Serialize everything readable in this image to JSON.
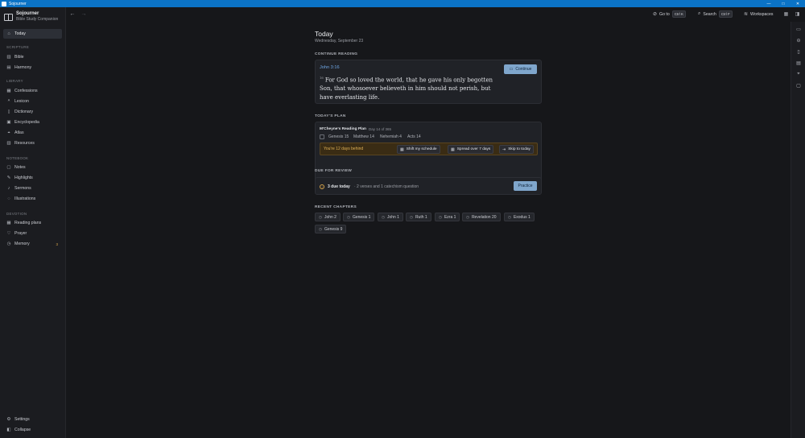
{
  "window": {
    "title": "Sojourner",
    "controls": [
      "—",
      "□",
      "✕"
    ]
  },
  "app": {
    "name": "Sojourner",
    "subtitle": "Bible Study Companion"
  },
  "sidebar": {
    "today": "Today",
    "sections": [
      {
        "label": "SCRIPTURE",
        "items": [
          "Bible",
          "Harmony"
        ]
      },
      {
        "label": "LIBRARY",
        "items": [
          "Confessions",
          "Lexicon",
          "Dictionary",
          "Encyclopedia",
          "Atlas",
          "Resources"
        ]
      },
      {
        "label": "NOTEBOOK",
        "items": [
          "Notes",
          "Highlights",
          "Sermons",
          "Illustrations"
        ]
      },
      {
        "label": "DEVOTION",
        "items": [
          "Reading plans",
          "Prayer",
          "Memory"
        ]
      }
    ],
    "memory_badge": "3",
    "footer": [
      "Settings",
      "Collapse"
    ]
  },
  "topbar": {
    "goto": {
      "label": "Go to",
      "shortcut": "Ctrl K"
    },
    "search": {
      "label": "Search",
      "shortcut": "Ctrl F"
    },
    "workspaces": {
      "label": "Workspaces"
    }
  },
  "page": {
    "title": "Today",
    "date": "Wednesday, September 23"
  },
  "continue_reading": {
    "heading": "CONTINUE READING",
    "reference": "John 3:16",
    "verse_number": "16",
    "text": "For God so loved the world, that he gave his only begotten Son, that whosoever believeth in him should not perish, but have everlasting life.",
    "button": "Continue"
  },
  "todays_plan": {
    "heading": "TODAY'S PLAN",
    "plan_name": "M'Cheyne's Reading Plan",
    "day": "Day 14 of 365",
    "chapters": [
      "Genesis 15",
      "Matthew 14",
      "Nehemiah 4",
      "Acts 14"
    ],
    "behind_text": "You're 12 days behind",
    "actions": [
      "Shift my schedule",
      "Spread over 7 days",
      "Skip to today"
    ]
  },
  "due_for_review": {
    "heading": "DUE FOR REVIEW",
    "count_text": "3 due today",
    "detail": "· 2 verses and 1 catechism question",
    "button": "Practice"
  },
  "recent_chapters": {
    "heading": "RECENT CHAPTERS",
    "chapters": [
      "John 2",
      "Genesis 1",
      "John 1",
      "Ruth 1",
      "Ezra 1",
      "Revelation 20",
      "Exodus 1",
      "Genesis 9"
    ]
  },
  "colors": {
    "titlebar": "#0b73c6",
    "background": "#16171a",
    "accent": "#7fa6cc",
    "warning": "#e1b256",
    "link": "#6fa8e6"
  }
}
